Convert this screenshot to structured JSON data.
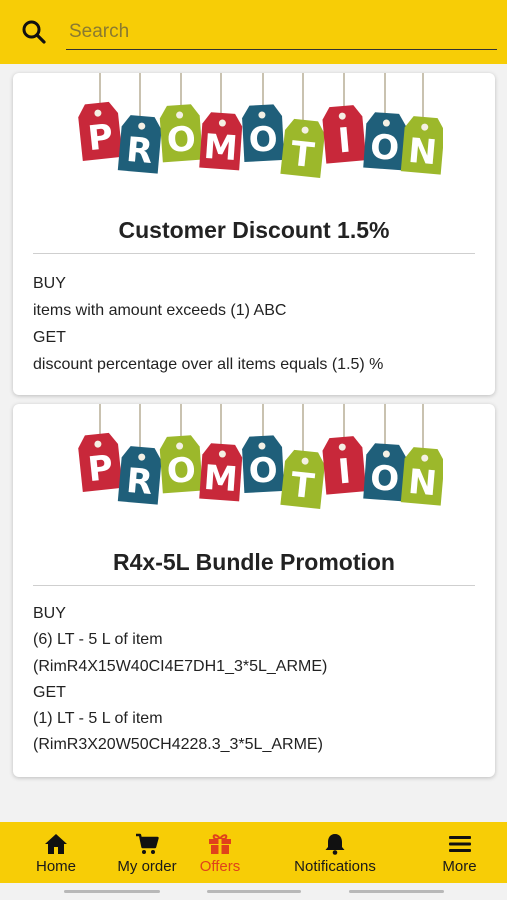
{
  "search": {
    "placeholder": "Search"
  },
  "promotions": [
    {
      "banner_letters": [
        "P",
        "R",
        "O",
        "M",
        "O",
        "T",
        "I",
        "O",
        "N"
      ],
      "title": "Customer Discount 1.5%",
      "lines": [
        "BUY",
        "items with amount exceeds (1) ABC",
        "GET",
        "discount percentage over all items equals (1.5) %"
      ]
    },
    {
      "banner_letters": [
        "P",
        "R",
        "O",
        "M",
        "O",
        "T",
        "I",
        "O",
        "N"
      ],
      "title": "R4x-5L Bundle Promotion",
      "lines": [
        "BUY",
        "(6) LT - 5 L of item",
        "(RimR4X15W40CI4E7DH1_3*5L_ARME)",
        "GET",
        "(1) LT - 5 L of item",
        "(RimR3X20W50CH4228.3_3*5L_ARME)"
      ]
    }
  ],
  "nav": {
    "items": [
      {
        "label": "Home",
        "icon": "home-icon"
      },
      {
        "label": "My order",
        "icon": "cart-icon"
      },
      {
        "label": "Offers",
        "icon": "gift-icon",
        "active": true
      },
      {
        "label": "Notifications",
        "icon": "bell-icon"
      },
      {
        "label": "More",
        "icon": "menu-icon"
      }
    ]
  },
  "colors": {
    "header_bg": "#f7cd06",
    "active_nav": "#e0421b",
    "tag_red": "#c8283a",
    "tag_teal": "#1f5f7a",
    "tag_green": "#9cb82b"
  }
}
